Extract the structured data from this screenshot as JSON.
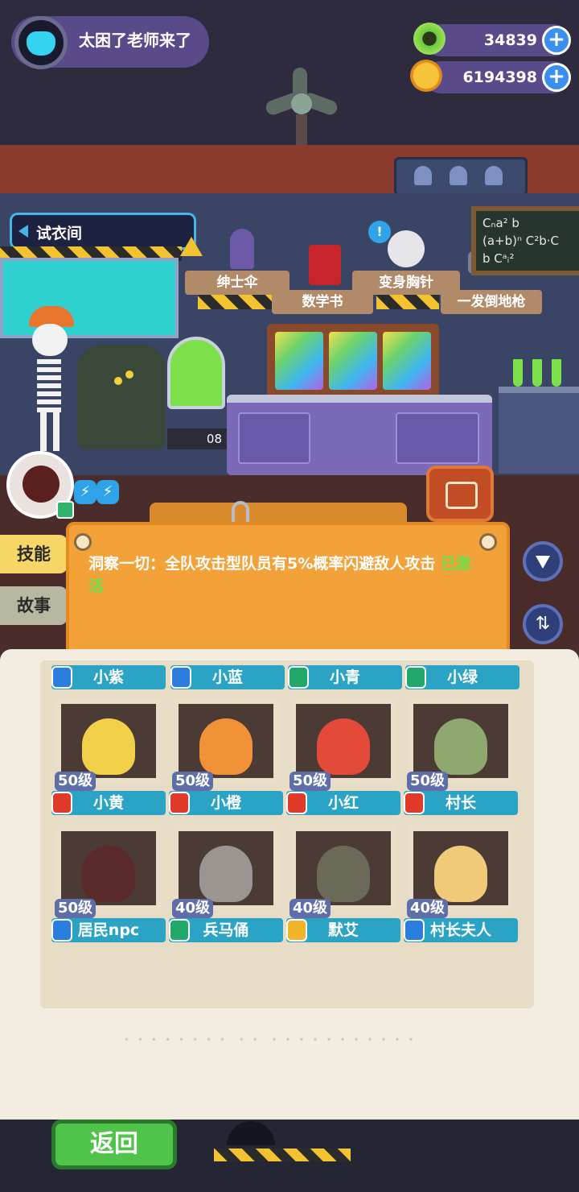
{
  "player": {
    "name": "太困了老师来了",
    "avatar_icon": "cat-icon"
  },
  "currency": {
    "gems": {
      "value": "34839",
      "icon": "donut-coin-icon"
    },
    "coins": {
      "value": "6194398",
      "icon": "planet-coin-icon"
    }
  },
  "scene": {
    "fitting_room": "试衣间",
    "shelf_items": [
      "绅士伞",
      "数学书",
      "变身胸针",
      "一发倒地枪"
    ],
    "blackboard_lines": [
      "Cₙa² b",
      "(a+b)ⁿ  C²b·C",
      "b    Cᵃᵢ²"
    ],
    "counter_label": "08"
  },
  "side_tabs": {
    "skill": "技能",
    "story": "故事"
  },
  "skill": {
    "text": "洞察一切：全队攻击型队员有5%概率闪避敌人攻击",
    "status": "已激活",
    "colors": {
      "text": "#ffffff",
      "active": "#6ae04a"
    }
  },
  "top_row": [
    {
      "name": "小紫",
      "badge_color": "#2c7de0"
    },
    {
      "name": "小蓝",
      "badge_color": "#2c7de0"
    },
    {
      "name": "小青",
      "badge_color": "#22a86a"
    },
    {
      "name": "小绿",
      "badge_color": "#22a86a"
    }
  ],
  "characters": [
    {
      "name": "小黄",
      "level": "50级",
      "badge_color": "#e23a2a",
      "face": "#f2d04a"
    },
    {
      "name": "小橙",
      "level": "50级",
      "badge_color": "#e23a2a",
      "face": "#f19238"
    },
    {
      "name": "小红",
      "level": "50级",
      "badge_color": "#e23a2a",
      "face": "#e34a3a"
    },
    {
      "name": "村长",
      "level": "50级",
      "badge_color": "#e23a2a",
      "face": "#8fa870"
    },
    {
      "name": "居民npc",
      "level": "50级",
      "badge_color": "#2c7de0",
      "face": "#5a2b2a"
    },
    {
      "name": "兵马俑",
      "level": "40级",
      "badge_color": "#22a86a",
      "face": "#9a9590"
    },
    {
      "name": "默艾",
      "level": "40级",
      "badge_color": "#f2b52a",
      "face": "#6b6a58"
    },
    {
      "name": "村长夫人",
      "level": "40级",
      "badge_color": "#2c7de0",
      "face": "#f0c979"
    }
  ],
  "faded_text": "・・・・・・・・  ・・  ・・・・・・・・・・・",
  "back_button": "返回"
}
